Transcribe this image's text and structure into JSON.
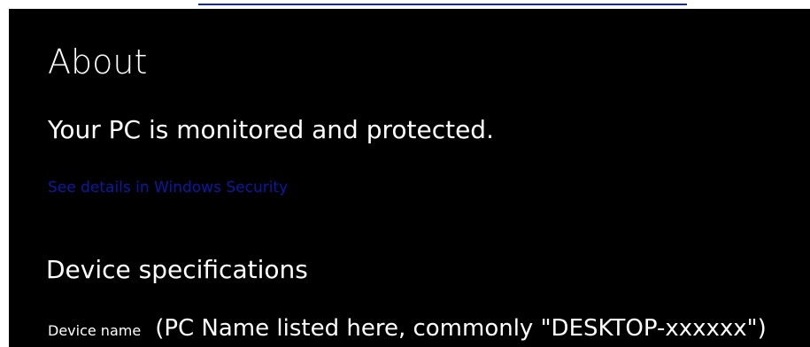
{
  "page": {
    "title": "About"
  },
  "security": {
    "status": "Your PC is monitored and protected.",
    "link_label": "See details in Windows Security"
  },
  "device_specifications": {
    "heading": "Device specifications",
    "device_name_label": "Device name",
    "device_name_value": "(PC Name listed here, commonly \"DESKTOP-xxxxxx\")"
  },
  "colors": {
    "background": "#000000",
    "text": "#ffffff",
    "link": "#0b1aa6",
    "top_accent": "#1a2a8c"
  }
}
